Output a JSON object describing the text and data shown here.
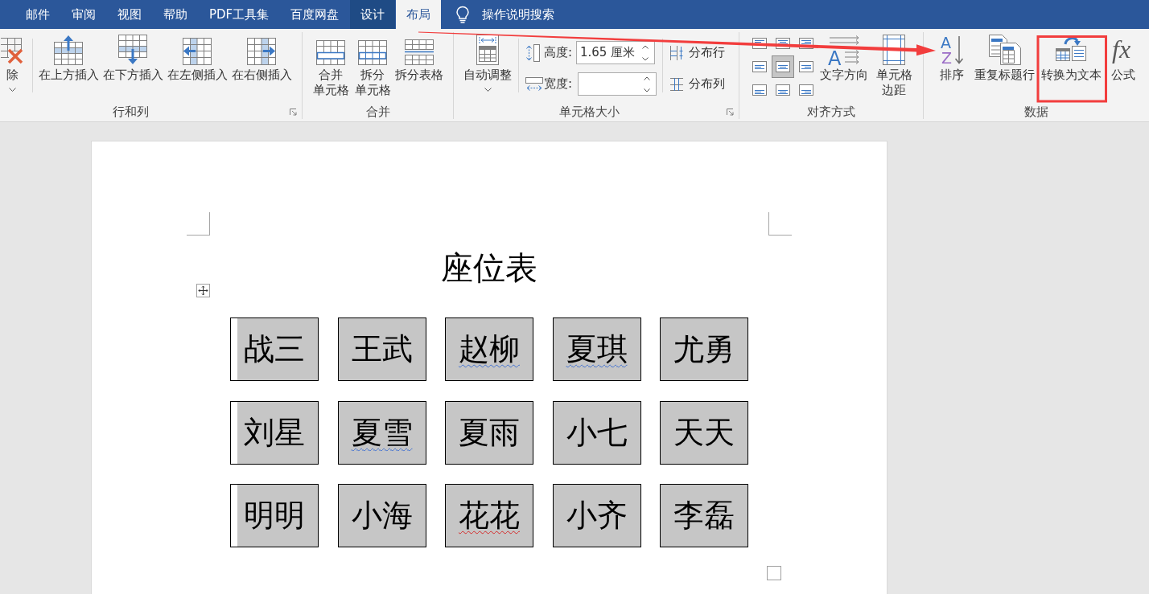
{
  "tabs": [
    {
      "label": "邮件",
      "selected": false,
      "contextual": false
    },
    {
      "label": "审阅",
      "selected": false,
      "contextual": false
    },
    {
      "label": "视图",
      "selected": false,
      "contextual": false
    },
    {
      "label": "帮助",
      "selected": false,
      "contextual": false
    },
    {
      "label": "PDF工具集",
      "selected": false,
      "contextual": false
    },
    {
      "label": "百度网盘",
      "selected": false,
      "contextual": false
    },
    {
      "label": "设计",
      "selected": false,
      "contextual": true
    },
    {
      "label": "布局",
      "selected": true,
      "contextual": true
    }
  ],
  "tell_me": {
    "label": "操作说明搜索"
  },
  "ribbon": {
    "groups": [
      {
        "label": "行和列",
        "launcher": true,
        "items": [
          {
            "kind": "large",
            "label": "除",
            "dropdown": true
          },
          {
            "kind": "separator"
          },
          {
            "kind": "large",
            "label": "在上方插入",
            "dropdown": false
          },
          {
            "kind": "large",
            "label": "在下方插入",
            "dropdown": false
          },
          {
            "kind": "large",
            "label": "在左侧插入",
            "dropdown": false
          },
          {
            "kind": "large",
            "label": "在右侧插入",
            "dropdown": false
          }
        ]
      },
      {
        "label": "合并",
        "launcher": false,
        "items": [
          {
            "kind": "large",
            "label": "合并单元格",
            "dropdown": false
          },
          {
            "kind": "large",
            "label": "拆分单元格",
            "dropdown": false
          },
          {
            "kind": "large",
            "label": "拆分表格",
            "dropdown": false
          }
        ]
      },
      {
        "label": "单元格大小",
        "launcher": true,
        "items": [
          {
            "kind": "large",
            "label": "自动调整",
            "dropdown": true
          },
          {
            "kind": "separator"
          },
          {
            "kind": "fields",
            "fields": [
              {
                "label": "高度:",
                "value": "1.65 厘米"
              },
              {
                "label": "宽度:"
              }
            ]
          },
          {
            "kind": "separator"
          },
          {
            "kind": "small",
            "buttons": [
              {
                "label": "分布行"
              },
              {
                "label": "分布列"
              }
            ]
          }
        ]
      },
      {
        "label": "对齐方式",
        "launcher": false,
        "items": [
          {
            "kind": "align-grid",
            "cells": [
              {
                "selected": false
              },
              {
                "selected": false
              },
              {
                "selected": false
              },
              {
                "selected": false
              },
              {
                "selected": true
              },
              {
                "selected": false
              },
              {
                "selected": false
              },
              {
                "selected": false
              },
              {
                "selected": false
              }
            ]
          },
          {
            "kind": "large",
            "label": "文字方向",
            "dropdown": false,
            "glyphs": [
              "A"
            ]
          },
          {
            "kind": "large",
            "label": "单元格边距",
            "dropdown": false
          }
        ]
      },
      {
        "label": "数据",
        "launcher": false,
        "items": [
          {
            "kind": "large",
            "label": "排序",
            "dropdown": false,
            "glyphs": [
              "A",
              "Z"
            ]
          },
          {
            "kind": "large",
            "label": "重复标题行",
            "dropdown": false
          },
          {
            "kind": "large",
            "label": "转换为文本",
            "dropdown": false
          },
          {
            "kind": "large",
            "label": "公式",
            "dropdown": false,
            "glyphs": [
              "fx"
            ]
          }
        ]
      }
    ]
  },
  "document": {
    "title": "座位表",
    "table": {
      "rows": [
        {
          "cells": [
            {
              "text": "战三",
              "grammar_error": false,
              "spelling_error": false
            },
            {
              "text": "王武",
              "grammar_error": false,
              "spelling_error": false
            },
            {
              "text": "赵柳",
              "grammar_error": true,
              "spelling_error": false
            },
            {
              "text": "夏琪",
              "grammar_error": true,
              "spelling_error": false
            },
            {
              "text": "尤勇",
              "grammar_error": false,
              "spelling_error": false
            }
          ]
        },
        {
          "cells": [
            {
              "text": "刘星",
              "grammar_error": false,
              "spelling_error": false
            },
            {
              "text": "夏雪",
              "grammar_error": true,
              "spelling_error": false
            },
            {
              "text": "夏雨",
              "grammar_error": false,
              "spelling_error": false
            },
            {
              "text": "小七",
              "grammar_error": false,
              "spelling_error": false
            },
            {
              "text": "天天",
              "grammar_error": false,
              "spelling_error": false
            }
          ]
        },
        {
          "cells": [
            {
              "text": "明明",
              "grammar_error": false,
              "spelling_error": false
            },
            {
              "text": "小海",
              "grammar_error": false,
              "spelling_error": false
            },
            {
              "text": "花花",
              "grammar_error": false,
              "spelling_error": true
            },
            {
              "text": "小齐",
              "grammar_error": false,
              "spelling_error": false
            },
            {
              "text": "李磊",
              "grammar_error": false,
              "spelling_error": false
            }
          ]
        }
      ]
    }
  }
}
